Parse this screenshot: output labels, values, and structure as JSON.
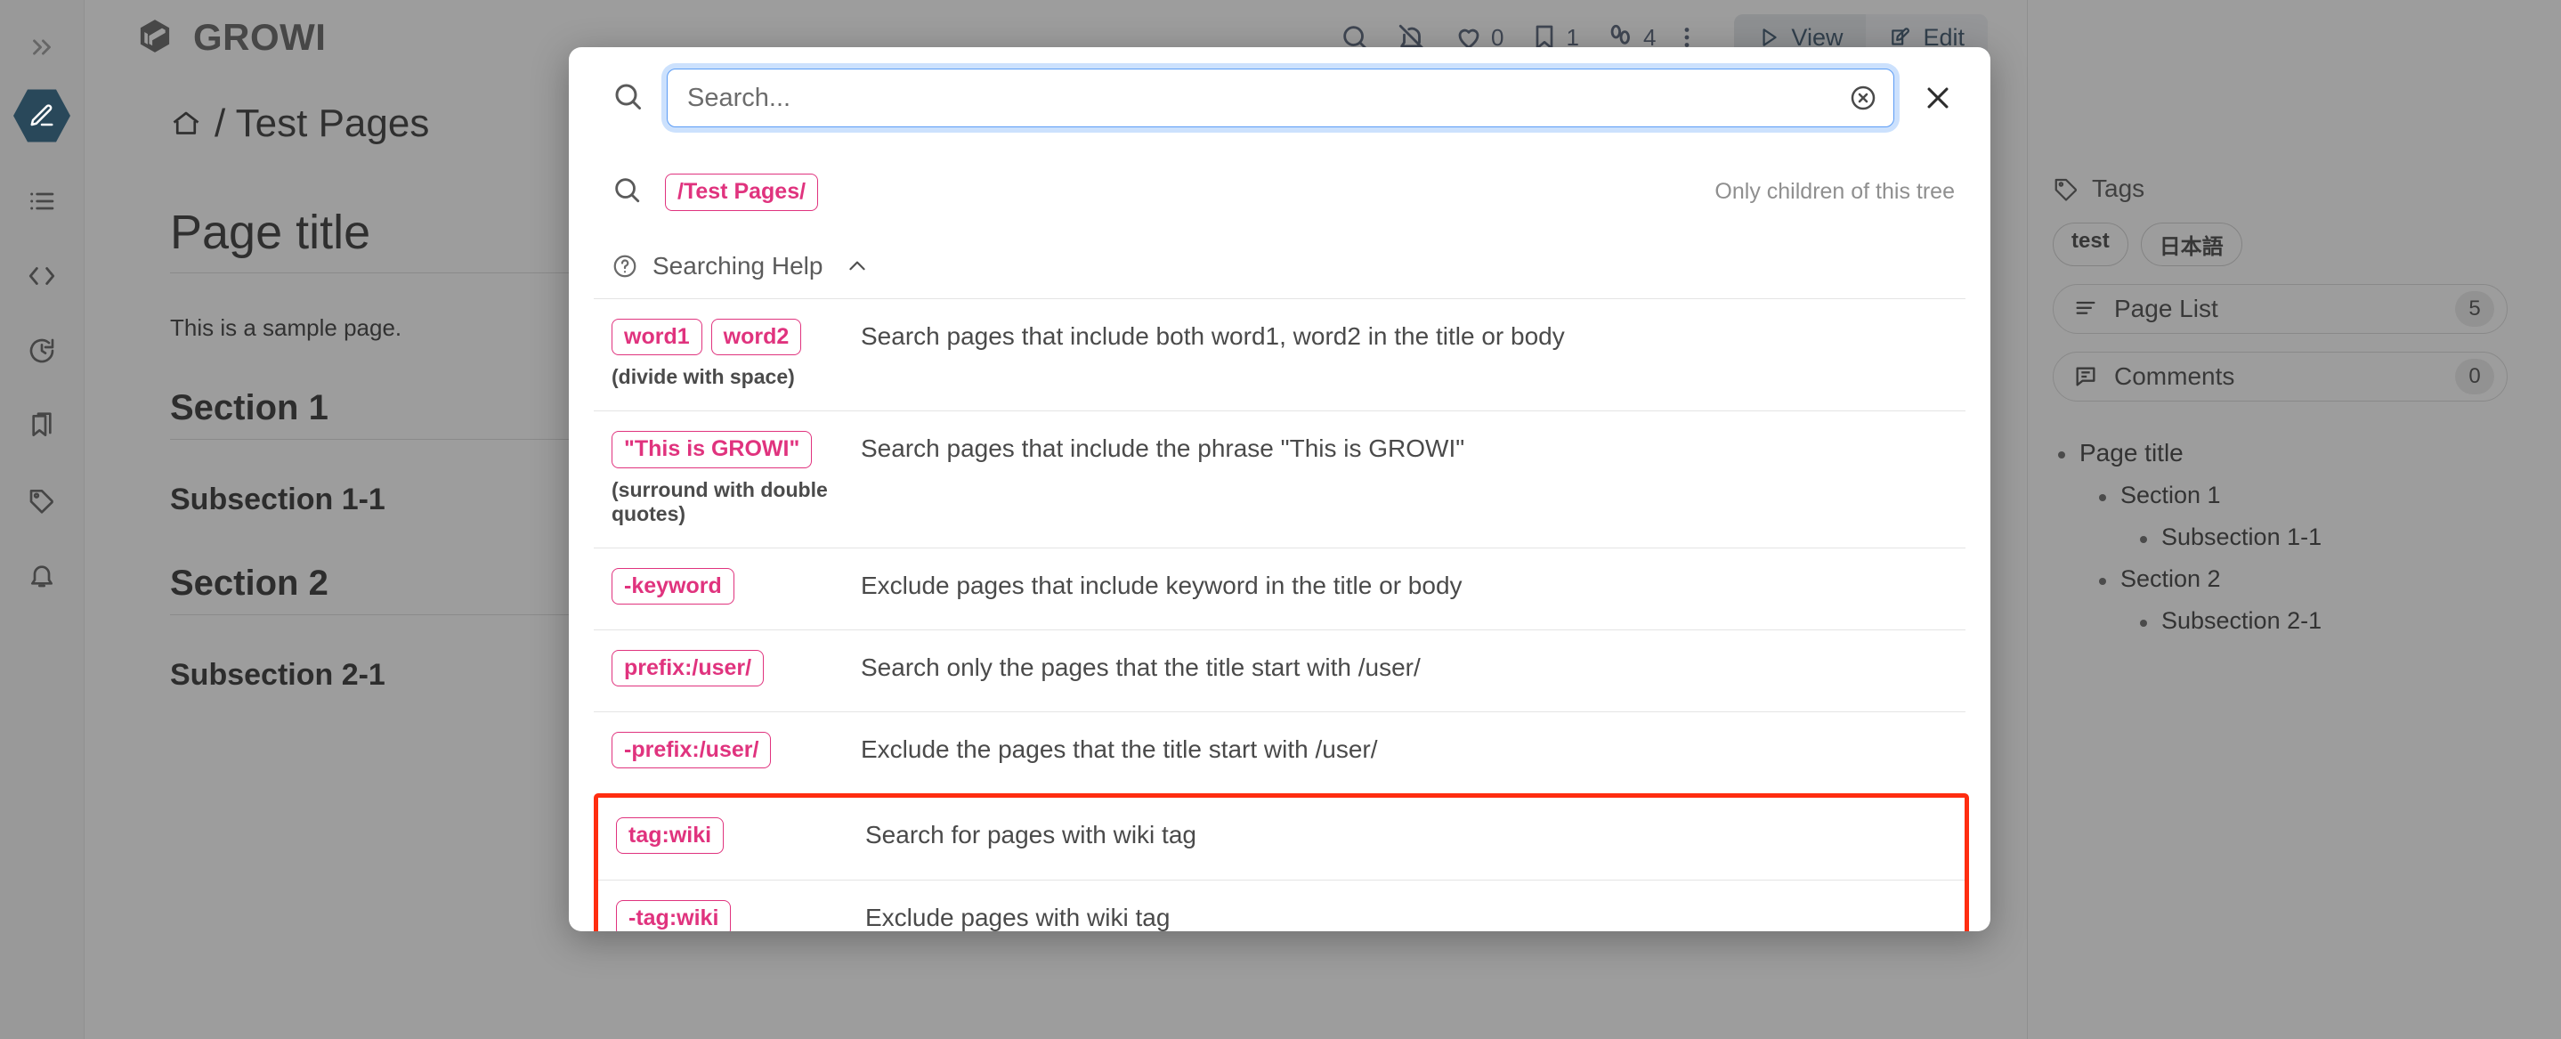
{
  "app": {
    "brand": "GROWI",
    "topbar": {
      "icons": [
        {
          "name": "search-icon",
          "glyph": "search"
        },
        {
          "name": "bell-off-icon",
          "glyph": "bell-off"
        },
        {
          "name": "heart-icon",
          "glyph": "heart",
          "count": "0"
        },
        {
          "name": "bookmark-icon",
          "glyph": "bookmark",
          "count": "1"
        },
        {
          "name": "footprints-icon",
          "glyph": "footprints",
          "count": "4"
        },
        {
          "name": "kebab-menu-icon",
          "glyph": "dots"
        }
      ],
      "view_label": "View",
      "edit_label": "Edit"
    },
    "sidebar_items": [
      {
        "name": "editor-icon",
        "label": "Editor"
      },
      {
        "name": "page-tree-icon",
        "label": "Page Tree"
      },
      {
        "name": "code-icon",
        "label": "Custom Sidebar"
      },
      {
        "name": "recent-changes-icon",
        "label": "Recent Changes"
      },
      {
        "name": "bookmarks-icon",
        "label": "Bookmarks"
      },
      {
        "name": "tags-icon",
        "label": "Tags"
      },
      {
        "name": "notification-icon",
        "label": "In-App Notification"
      }
    ],
    "page": {
      "breadcrumb": "/ Test Pages",
      "title": "Page title",
      "paragraph": "This is a sample page.",
      "section1": "Section 1",
      "subsection11": "Subsection 1-1",
      "section2": "Section 2",
      "subsection21": "Subsection 2-1"
    },
    "right_rail": {
      "tags_label": "Tags",
      "tags": [
        "test",
        "日本語"
      ],
      "page_list_label": "Page List",
      "page_list_count": "5",
      "comments_label": "Comments",
      "comments_count": "0",
      "toc": [
        {
          "label": "Page title",
          "level": 1
        },
        {
          "label": "Section 1",
          "level": 2
        },
        {
          "label": "Subsection 1-1",
          "level": 3
        },
        {
          "label": "Section 2",
          "level": 2
        },
        {
          "label": "Subsection 2-1",
          "level": 3
        }
      ]
    }
  },
  "modal": {
    "search": {
      "value": "",
      "placeholder": "Search..."
    },
    "scope": {
      "badge": "/Test Pages/",
      "hint": "Only children of this tree"
    },
    "help": {
      "title": "Searching Help",
      "rows": [
        {
          "badges": [
            "word1",
            "word2"
          ],
          "note": "(divide with space)",
          "desc": "Search pages that include both word1, word2 in the title or body",
          "highlighted": false
        },
        {
          "badges": [
            "\"This is GROWI\""
          ],
          "note": "(surround with double quotes)",
          "desc": "Search pages that include the phrase \"This is GROWI\"",
          "highlighted": false
        },
        {
          "badges": [
            "-keyword"
          ],
          "note": "",
          "desc": "Exclude pages that include keyword in the title or body",
          "highlighted": false
        },
        {
          "badges": [
            "prefix:/user/"
          ],
          "note": "",
          "desc": "Search only the pages that the title start with /user/",
          "highlighted": false
        },
        {
          "badges": [
            "-prefix:/user/"
          ],
          "note": "",
          "desc": "Exclude the pages that the title start with /user/",
          "highlighted": false
        }
      ],
      "highlighted_rows": [
        {
          "badges": [
            "tag:wiki"
          ],
          "note": "",
          "desc": "Search for pages with wiki tag"
        },
        {
          "badges": [
            "-tag:wiki"
          ],
          "note": "",
          "desc": "Exclude pages with wiki tag"
        }
      ]
    }
  },
  "colors": {
    "badge_pink": "#e0337e",
    "highlight_red": "#ff2d10",
    "focus_blue": "#5b9cf5",
    "accent_navy": "#0d4f73"
  }
}
